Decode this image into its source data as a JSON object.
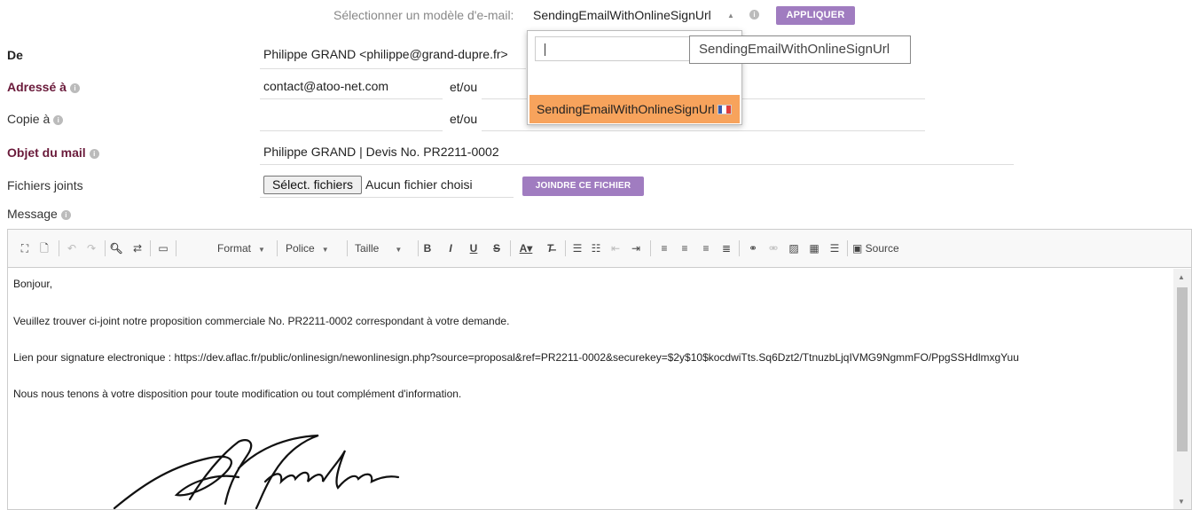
{
  "template": {
    "label": "Sélectionner un modèle d'e-mail:",
    "selected": "SendingEmailWithOnlineSignUrl",
    "apply_label": "APPLIQUER",
    "search_value": "",
    "options": [
      {
        "label": "SendingEmailWithOnlineSignUrl",
        "flag": "fr"
      }
    ],
    "tooltip": "SendingEmailWithOnlineSignUrl"
  },
  "form": {
    "from": {
      "label": "De",
      "value": "Philippe GRAND <philippe@grand-dupre.fr>"
    },
    "to": {
      "label": "Adressé à",
      "value": "contact@atoo-net.com",
      "andor": "et/ou"
    },
    "cc": {
      "label": "Copie à",
      "value": "",
      "andor": "et/ou"
    },
    "subject": {
      "label": "Objet du mail",
      "value": "Philippe GRAND | Devis No. PR2211-0002"
    },
    "attachments": {
      "label": "Fichiers joints",
      "button": "Sélect. fichiers",
      "status": "Aucun fichier choisi",
      "join_label": "JOINDRE CE FICHIER"
    },
    "message": {
      "label": "Message"
    }
  },
  "editor": {
    "toolbar": {
      "format": "Format",
      "font": "Police",
      "size": "Taille",
      "bold": "B",
      "italic": "I",
      "underline": "U",
      "strike": "S",
      "source": "Source"
    },
    "lines": [
      "Bonjour,",
      "Veuillez trouver ci-joint notre proposition commerciale No. PR2211-0002 correspondant à votre demande.",
      "Lien pour signature electronique : https://dev.aflac.fr/public/onlinesign/newonlinesign.php?source=proposal&ref=PR2211-0002&securekey=$2y$10$kocdwiTts.Sq6Dzt2/TtnuzbLjqIVMG9NgmmFO/PpgSSHdlmxgYuu",
      "Nous nous tenons à votre disposition pour toute modification ou tout complément d'information."
    ]
  },
  "colors": {
    "accent_purple": "#a07cc0",
    "highlight_orange": "#f7a35c",
    "required_label": "#6a1a3a"
  }
}
